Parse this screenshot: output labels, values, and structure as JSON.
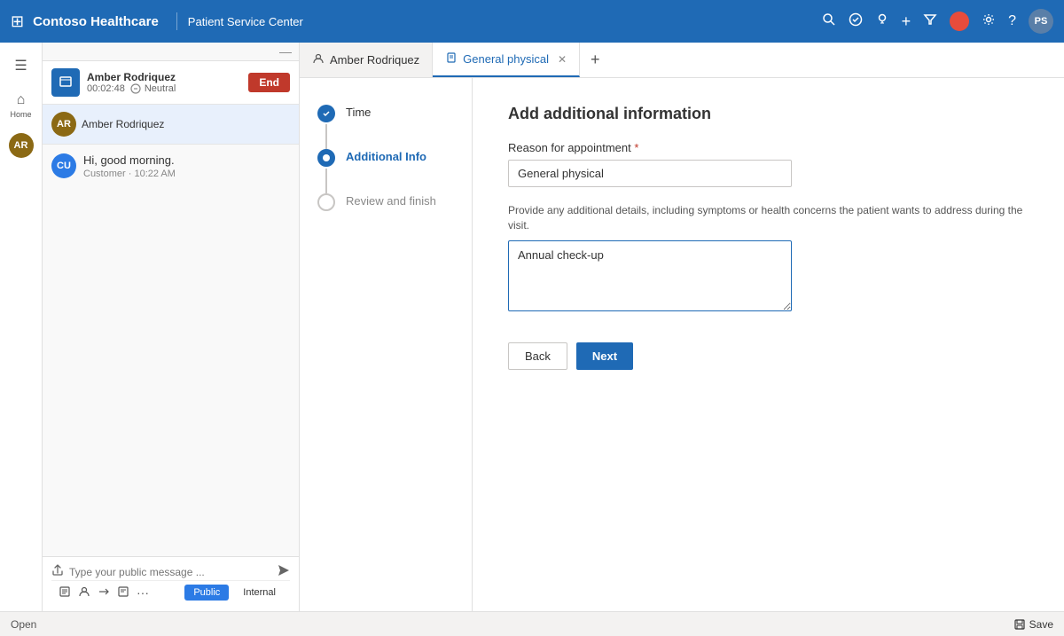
{
  "topNav": {
    "appTitle": "Contoso Healthcare",
    "divider": "|",
    "serviceCenter": "Patient Service Center",
    "gridIconLabel": "⊞",
    "searchIconLabel": "🔍",
    "todoIconLabel": "✓",
    "bulbIconLabel": "💡",
    "plusIconLabel": "+",
    "filterIconLabel": "▽",
    "settingsIconLabel": "⚙",
    "helpIconLabel": "?",
    "avatarLabel": "PS"
  },
  "sidebar": {
    "hamburgerLabel": "☰",
    "homeLabel": "Home",
    "homeIconLabel": "⌂",
    "arAvatarLabel": "AR"
  },
  "callBar": {
    "callerName": "Amber Rodriquez",
    "callTime": "00:02:48",
    "neutralLabel": "Neutral",
    "endLabel": "End",
    "callerIconLabel": "📞"
  },
  "chat": {
    "bubbles": [
      {
        "avatarLabel": "CU",
        "text": "Hi, good morning.",
        "sender": "Customer",
        "time": "Customer · 10:22 AM"
      }
    ],
    "inputPlaceholder": "Type your public message ...",
    "attachIconLabel": "📎",
    "sendIconLabel": "➤",
    "toolIcons": [
      "T",
      "👤",
      "—",
      "✎",
      "···"
    ],
    "publicLabel": "Public",
    "internalLabel": "Internal"
  },
  "tabs": {
    "amberTab": {
      "iconLabel": "👤",
      "label": "Amber Rodriquez"
    },
    "physicalTab": {
      "iconLabel": "📋",
      "label": "General physical",
      "active": true
    },
    "addTabLabel": "+"
  },
  "stepper": {
    "steps": [
      {
        "id": "time",
        "label": "Time",
        "state": "completed"
      },
      {
        "id": "additional-info",
        "label": "Additional Info",
        "state": "active"
      },
      {
        "id": "review-finish",
        "label": "Review and finish",
        "state": "pending"
      }
    ]
  },
  "form": {
    "title": "Add additional information",
    "reasonLabel": "Reason for appointment",
    "reasonRequired": true,
    "reasonValue": "General physical",
    "detailsDescription": "Provide any additional details, including symptoms or health concerns the patient wants to address during the visit.",
    "detailsValue": "Annual check-up",
    "backLabel": "Back",
    "nextLabel": "Next"
  },
  "statusBar": {
    "openLabel": "Open",
    "saveLabel": "💾 Save"
  }
}
